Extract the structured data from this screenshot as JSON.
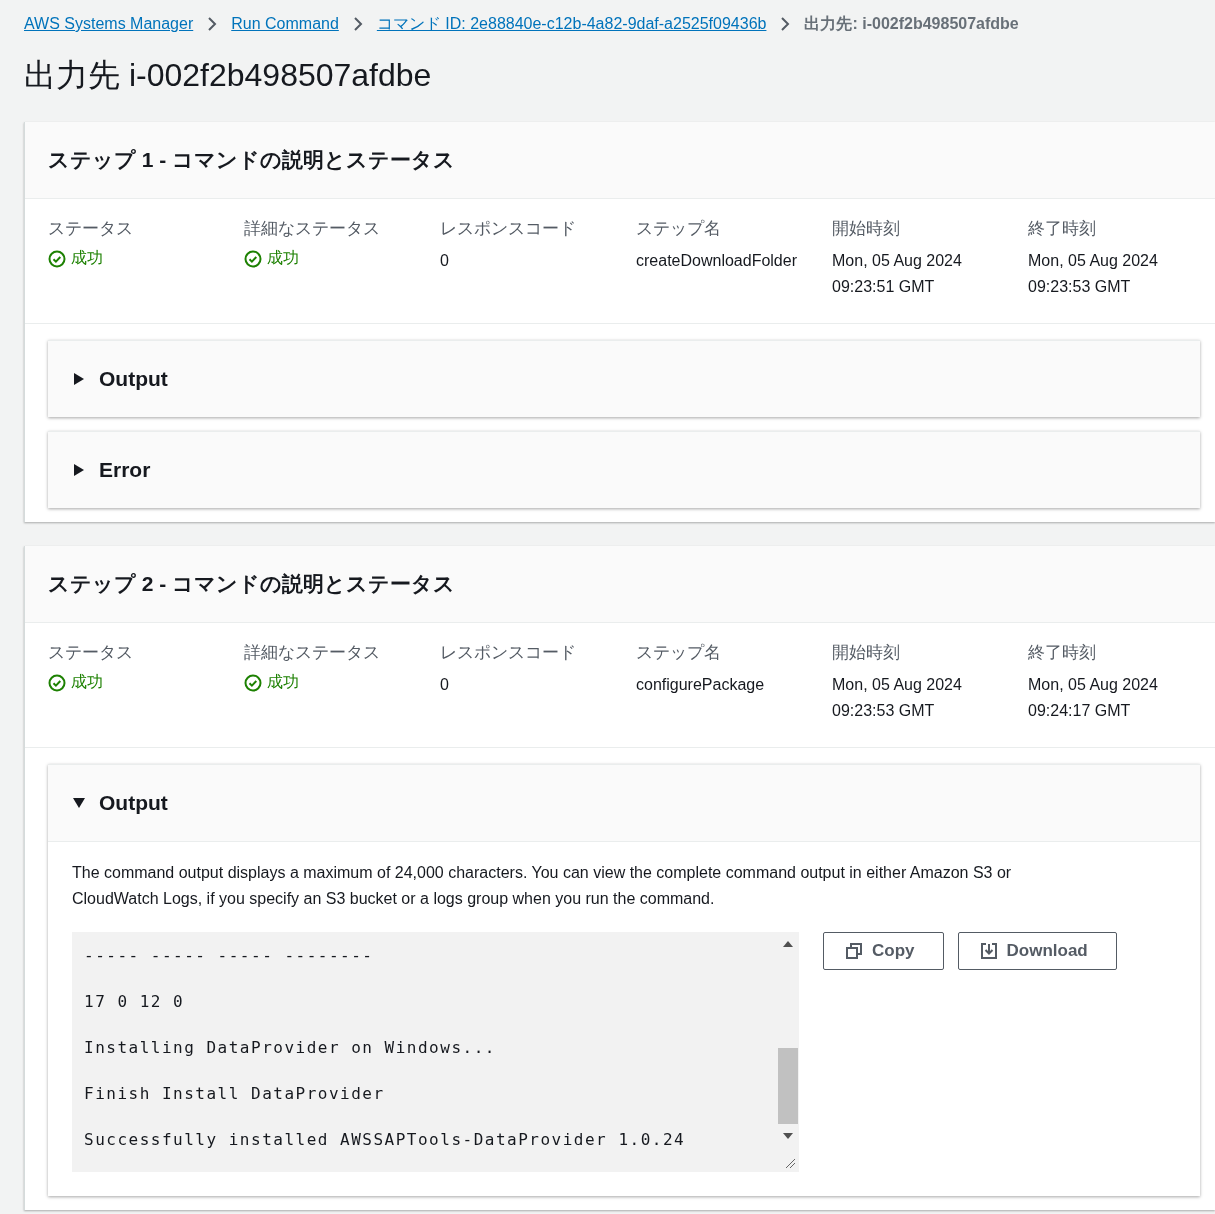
{
  "breadcrumbs": [
    {
      "label": "AWS Systems Manager",
      "kind": "link"
    },
    {
      "label": "Run Command",
      "kind": "link"
    },
    {
      "label": "コマンド ID: 2e88840e-c12b-4a82-9daf-a2525f09436b",
      "kind": "link"
    },
    {
      "label": "出力先: i-002f2b498507afdbe",
      "kind": "current"
    }
  ],
  "page_title": "出力先 i-002f2b498507afdbe",
  "steps": [
    {
      "title": "ステップ 1 - コマンドの説明とステータス",
      "fields": [
        {
          "label": "ステータス",
          "kind": "status",
          "value": "成功"
        },
        {
          "label": "詳細なステータス",
          "kind": "status",
          "value": "成功"
        },
        {
          "label": "レスポンスコード",
          "kind": "text",
          "value": "0"
        },
        {
          "label": "ステップ名",
          "kind": "text",
          "value": "createDownloadFolder"
        },
        {
          "label": "開始時刻",
          "kind": "text",
          "value": "Mon, 05 Aug 2024 09:23:51 GMT"
        },
        {
          "label": "終了時刻",
          "kind": "text",
          "value": "Mon, 05 Aug 2024 09:23:53 GMT"
        }
      ],
      "sections": [
        {
          "title": "Output",
          "expanded": false
        },
        {
          "title": "Error",
          "expanded": false
        }
      ]
    },
    {
      "title": "ステップ 2 - コマンドの説明とステータス",
      "fields": [
        {
          "label": "ステータス",
          "kind": "status",
          "value": "成功"
        },
        {
          "label": "詳細なステータス",
          "kind": "status",
          "value": "成功"
        },
        {
          "label": "レスポンスコード",
          "kind": "text",
          "value": "0"
        },
        {
          "label": "ステップ名",
          "kind": "text",
          "value": "configurePackage"
        },
        {
          "label": "開始時刻",
          "kind": "text",
          "value": "Mon, 05 Aug 2024 09:23:53 GMT"
        },
        {
          "label": "終了時刻",
          "kind": "text",
          "value": "Mon, 05 Aug 2024 09:24:17 GMT"
        }
      ],
      "sections": [
        {
          "title": "Output",
          "expanded": true,
          "description": "The command output displays a maximum of 24,000 characters. You can view the complete command output in either Amazon S3 or CloudWatch Logs, if you specify an S3 bucket or a logs group when you run the command.",
          "output_lines": [
            "----- ----- ----- --------",
            "17 0 12 0",
            "Installing DataProvider on Windows...",
            "Finish Install DataProvider",
            "Successfully installed AWSSAPTools-DataProvider 1.0.24"
          ],
          "buttons": [
            {
              "label": "Copy",
              "kind": "copy"
            },
            {
              "label": "Download",
              "kind": "download"
            }
          ]
        }
      ]
    }
  ]
}
